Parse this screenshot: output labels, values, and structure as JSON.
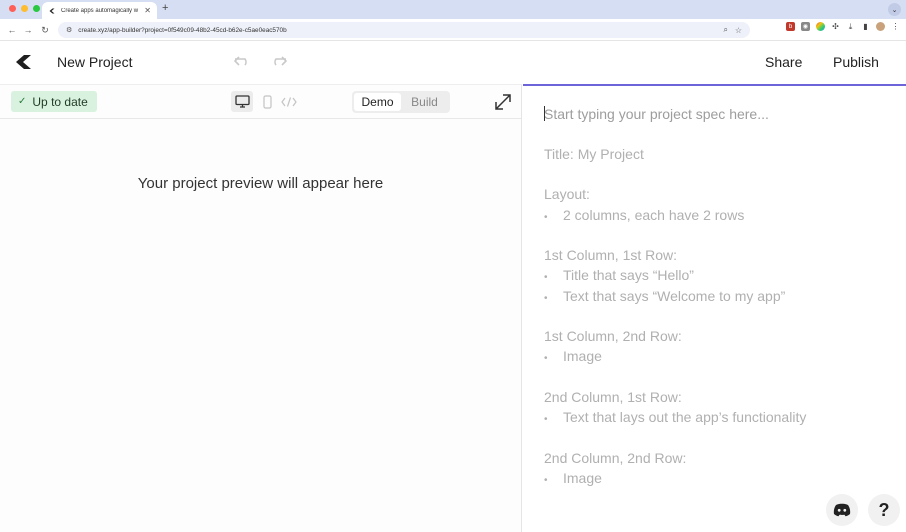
{
  "browser": {
    "tab_title": "Create apps automagically w",
    "tab_close": "✕",
    "new_tab": "+",
    "url": "create.xyz/app-builder?project=0f549c09-48b2-45cd-b62e-c5ae0eac570b",
    "colors": {
      "close": "#ff5f57",
      "minimize": "#febc2e",
      "maximize": "#28c840"
    }
  },
  "header": {
    "project_title": "New Project",
    "share_label": "Share",
    "publish_label": "Publish",
    "accent_color": "#6c64d8"
  },
  "preview": {
    "status_label": "Up to date",
    "status_check": "✓",
    "segmented": [
      {
        "label": "Demo",
        "active": true
      },
      {
        "label": "Build",
        "active": false
      }
    ],
    "message": "Your project preview will appear here"
  },
  "spec": {
    "placeholder": "Start typing your project spec here...",
    "lines": [
      "Title: My Project",
      "Layout:",
      "2 columns, each have 2 rows",
      "1st Column, 1st Row:",
      "Title that says “Hello”",
      "Text that says “Welcome to my app”",
      "1st Column, 2nd Row:",
      "Image",
      "2nd Column, 1st Row:",
      "Text that lays out the app’s functionality",
      "2nd Column, 2nd Row:",
      "Image"
    ],
    "bullet": "•"
  },
  "fabs": {
    "help_label": "?"
  }
}
